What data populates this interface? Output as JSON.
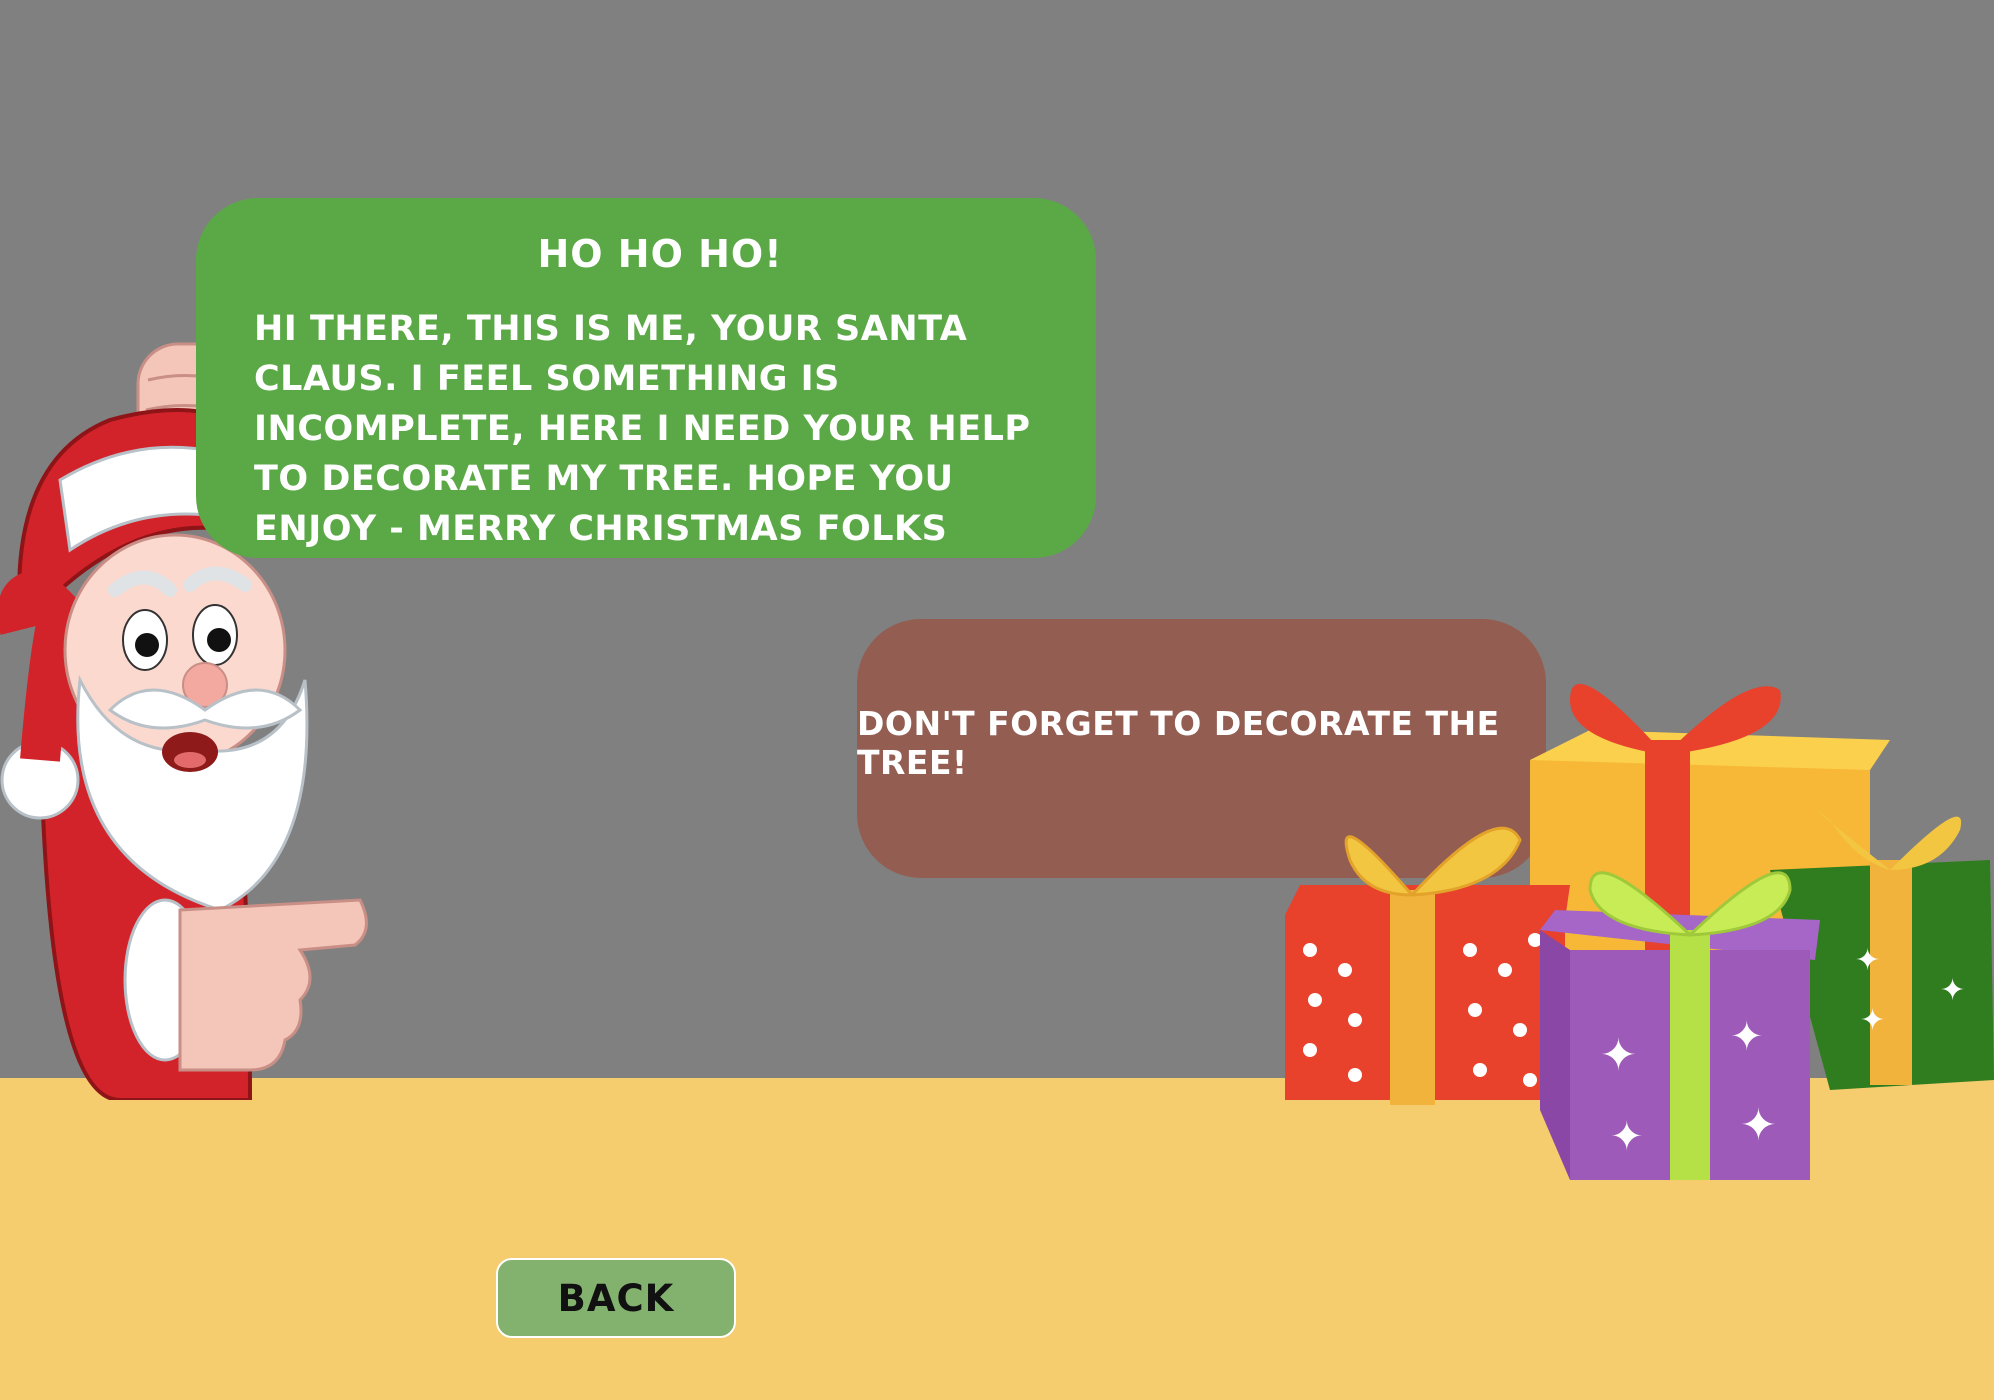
{
  "intro": {
    "title": "Ho ho ho!",
    "body": "Hi there, this is me, your Santa Claus. I feel something is incomplete, here I need your help to decorate my tree. Hope you enjoy - Merry Christmas folks"
  },
  "hint": {
    "text": "Don't forget to decorate the tree!"
  },
  "nav": {
    "back_label": "BACK"
  },
  "colors": {
    "background": "#808080",
    "floor": "#f5cc6e",
    "speech_bubble": "#5ba946",
    "hint_bubble": "#935d51",
    "back_button": "#83b26f"
  }
}
